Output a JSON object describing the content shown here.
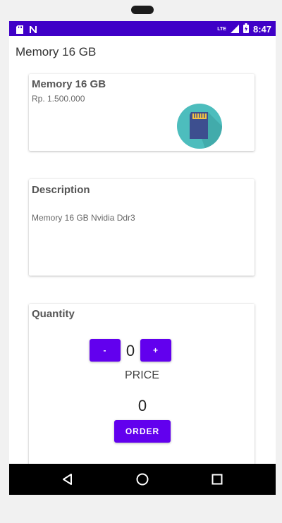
{
  "status_bar": {
    "time": "8:47",
    "icons": [
      "sd-card-icon",
      "n-notification-icon",
      "lte-icon",
      "signal-icon",
      "battery-icon"
    ],
    "lte_label": "LTE"
  },
  "app_bar": {
    "title": "Memory 16 GB"
  },
  "product": {
    "name": "Memory 16 GB",
    "price": "Rp. 1.500.000",
    "icon": "sd-card-icon"
  },
  "description": {
    "title": "Description",
    "text": "Memory 16 GB Nvidia Ddr3"
  },
  "quantity": {
    "title": "Quantity",
    "decrement_label": "-",
    "increment_label": "+",
    "value": "0",
    "price_label": "PRICE",
    "price_value": "0",
    "order_label": "ORDER"
  },
  "nav_bar": {
    "icons": [
      "back-icon",
      "home-icon",
      "recents-icon"
    ]
  },
  "colors": {
    "status_bar": "#3f00c7",
    "accent": "#6200ee",
    "icon_bg": "#4dbdbd"
  }
}
